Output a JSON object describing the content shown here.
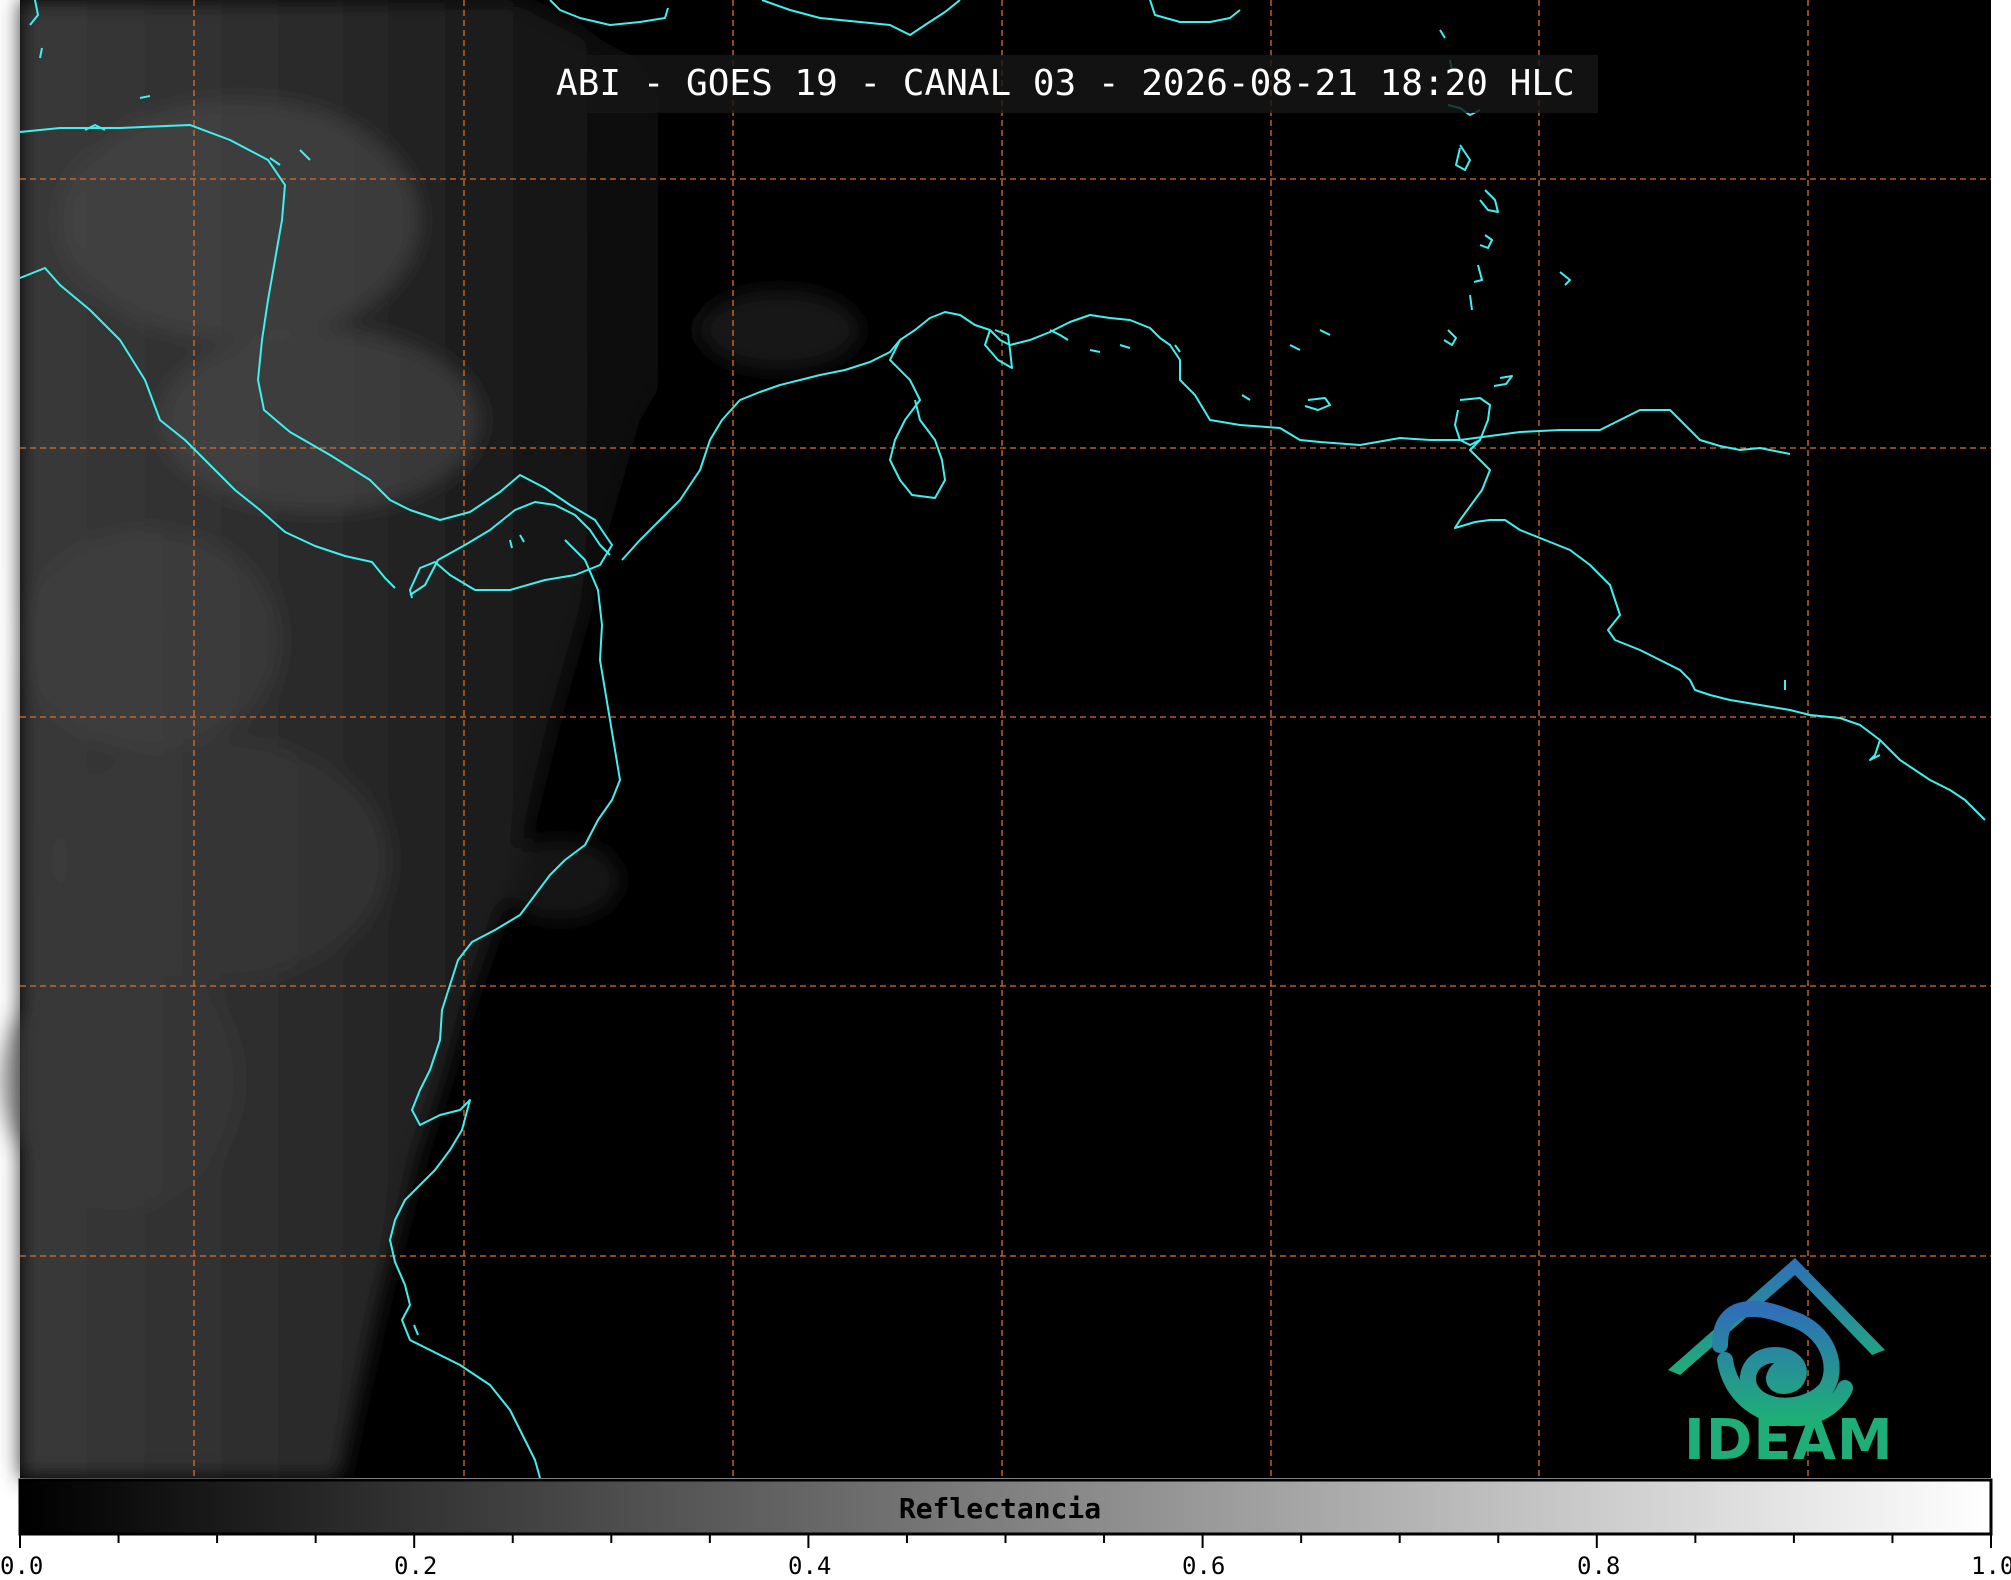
{
  "title": "ABI - GOES 19 - CANAL 03 - 2026-08-21 18:20 HLC",
  "colorbar": {
    "label": "Reflectancia",
    "ticks": [
      {
        "label": "0.0"
      },
      {
        "label": "0.2"
      },
      {
        "label": "0.4"
      },
      {
        "label": "0.6"
      },
      {
        "label": "0.8"
      },
      {
        "label": "1.0"
      }
    ],
    "range": [
      0.0,
      1.0
    ]
  },
  "logo": {
    "text": "IDEAM"
  },
  "colors": {
    "coastline": "#3ff0ee",
    "graticule": "#d9702a",
    "logo_text": "#1fae78",
    "logo_upper": "#2f7fb8"
  },
  "map": {
    "graticule_style": "dashed",
    "graticule_vertical_lines": 7,
    "graticule_horizontal_lines": 5
  }
}
